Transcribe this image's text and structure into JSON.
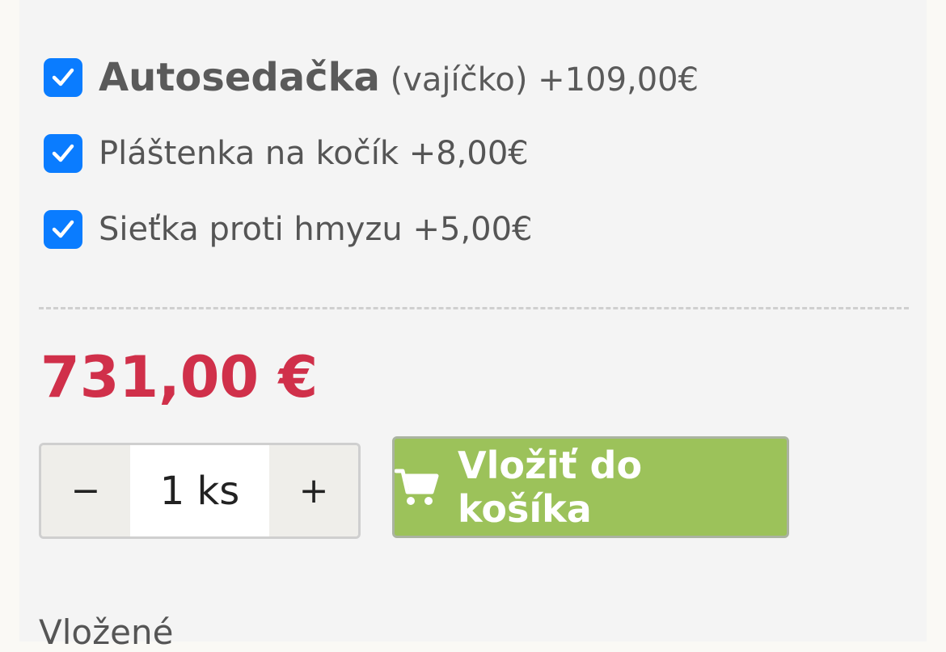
{
  "options": [
    {
      "name": "Autosedačka",
      "note": "(vajíčko)",
      "price": "+109,00€",
      "checked": true
    },
    {
      "label": "Pláštenka na kočík +8,00€",
      "checked": true
    },
    {
      "label": "Sieťka proti hmyzu +5,00€",
      "checked": true
    }
  ],
  "price": {
    "total": "731,00 €"
  },
  "quantity": {
    "minus": "−",
    "value": "1 ks",
    "plus": "+"
  },
  "cart": {
    "label": "Vložiť do košíka",
    "icon": "cart-icon"
  },
  "footer": {
    "text": "Vložené"
  },
  "colors": {
    "checkbox": "#0a7cff",
    "price": "#d0304a",
    "cart_button": "#9cc25a",
    "panel_bg": "#f4f4f4"
  }
}
